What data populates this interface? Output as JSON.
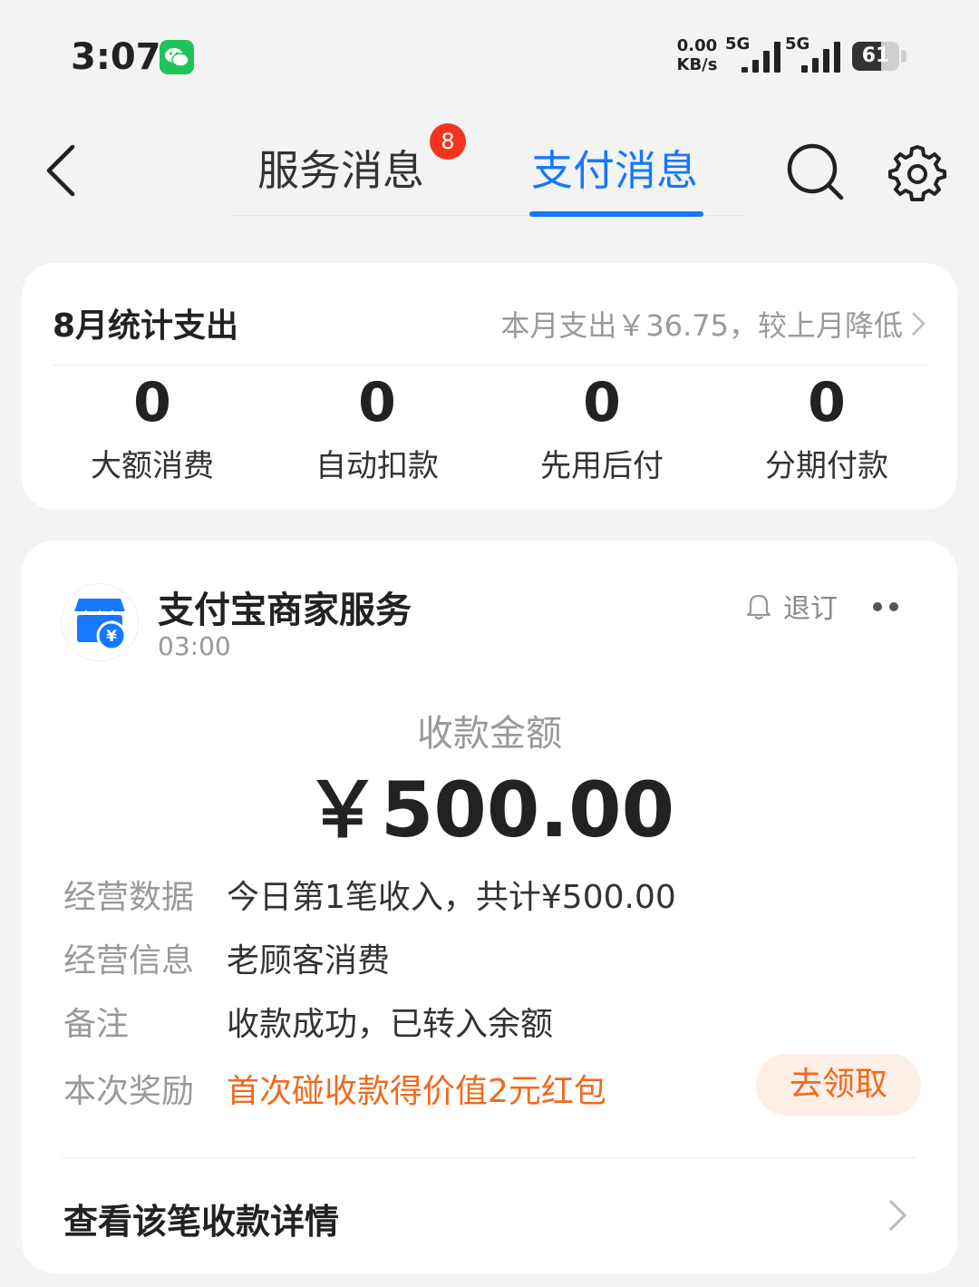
{
  "status_bar": {
    "time": "3:07",
    "net_speed_value": "0.00",
    "net_speed_unit": "KB/s",
    "signal1_label": "5G",
    "signal2_label": "5G",
    "battery_level": "61",
    "battery_fraction": 0.61
  },
  "nav": {
    "tabs": [
      {
        "label": "服务消息",
        "badge": "8",
        "active": false
      },
      {
        "label": "支付消息",
        "active": true
      }
    ],
    "active_color": "#1677ff"
  },
  "stats": {
    "title": "8月统计支出",
    "summary": "本月支出￥36.75，较上月降低",
    "items": [
      {
        "value": "0",
        "label": "大额消费"
      },
      {
        "value": "0",
        "label": "自动扣款"
      },
      {
        "value": "0",
        "label": "先用后付"
      },
      {
        "value": "0",
        "label": "分期付款"
      }
    ]
  },
  "message": {
    "merchant": "支付宝商家服务",
    "time": "03:00",
    "unsubscribe": "退订",
    "amount_label": "收款金额",
    "amount": "￥500.00",
    "rows": [
      {
        "label": "经营数据",
        "value": "今日第1笔收入，共计¥500.00"
      },
      {
        "label": "经营信息",
        "value": "老顾客消费"
      },
      {
        "label": "备注",
        "value": "收款成功，已转入余额"
      },
      {
        "label": "本次奖励",
        "value": "首次碰收款得价值2元红包"
      }
    ],
    "claim_button": "去领取",
    "detail_link": "查看该笔收款详情",
    "accent_orange": "#f06a1c"
  }
}
